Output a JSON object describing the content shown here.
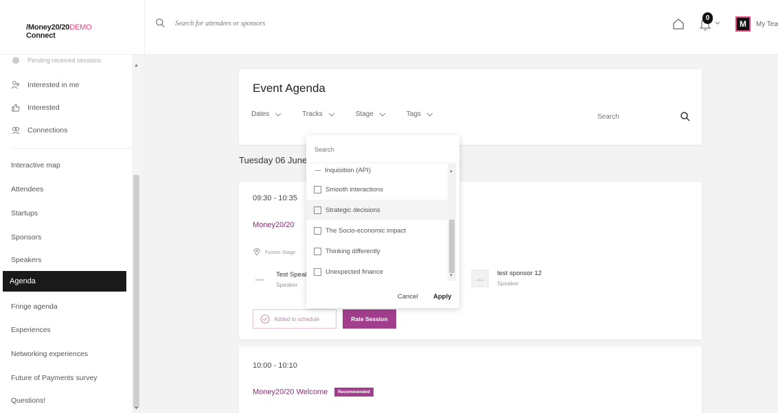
{
  "topbar": {
    "logo_main": "/Money20/20",
    "logo_demo": "DEMO",
    "logo_sub": "Connect",
    "search_placeholder": "Search for attendees or sponsors",
    "notification_count": "0",
    "avatar_letter": "M",
    "team_label": "My Team"
  },
  "sidebar": {
    "partial_item": "Pending received sessions",
    "icon_items": [
      {
        "label": "Interested in me",
        "icon": "people-icon"
      },
      {
        "label": "Interested",
        "icon": "thumbs-up-icon"
      },
      {
        "label": "Connections",
        "icon": "connections-icon"
      }
    ],
    "items": [
      "Interactive map",
      "Attendees",
      "Startups",
      "Sponsors",
      "Speakers",
      "Agenda",
      "Fringe agenda",
      "Experiences",
      "Networking experiences",
      "Future of Payments survey",
      "Questions!"
    ],
    "active_item": "Agenda"
  },
  "agenda": {
    "title": "Event Agenda",
    "filters": [
      "Dates",
      "Tracks",
      "Stage",
      "Tags"
    ],
    "search_placeholder": "Search",
    "date_heading": "Tuesday 06 June"
  },
  "session1": {
    "time": "09:30 - 10:35",
    "title": "Money20/20",
    "location": "Fusion Stage",
    "speaker1_name": "Test Speaker",
    "speaker1_role": "Speaker",
    "speaker2_name": "test sponsor 12",
    "speaker2_role": "Speaker",
    "added_label": "Added to schedule",
    "rate_label": "Rate Session"
  },
  "session2": {
    "time": "10:00 - 10:10",
    "title": "Money20/20 Welcome",
    "badge": "Recommended"
  },
  "dropdown": {
    "search_placeholder": "Search",
    "items": [
      {
        "label": "Inquisition (API)",
        "partial": true
      },
      {
        "label": "Smooth interactions"
      },
      {
        "label": "Strategic decisions",
        "hover": true
      },
      {
        "label": "The Socio-economic impact"
      },
      {
        "label": "Thinking differently"
      },
      {
        "label": "Unexpected finance"
      }
    ],
    "cancel_label": "Cancel",
    "apply_label": "Apply"
  },
  "colors": {
    "accent": "#a23f8d",
    "brand_pink": "#e6457a",
    "active_nav": "#1a1a1a"
  }
}
